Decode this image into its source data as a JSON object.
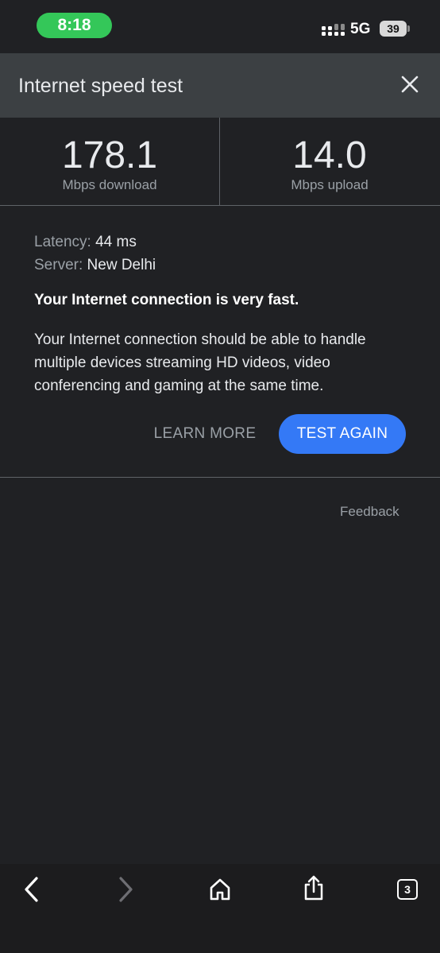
{
  "status_bar": {
    "time": "8:18",
    "network": "5G",
    "battery": "39"
  },
  "header": {
    "title": "Internet speed test"
  },
  "results": {
    "download": {
      "value": "178.1",
      "unit": "Mbps download"
    },
    "upload": {
      "value": "14.0",
      "unit": "Mbps upload"
    }
  },
  "details": {
    "latency_label": "Latency:",
    "latency_value": "44 ms",
    "server_label": "Server:",
    "server_value": "New Delhi"
  },
  "verdict": "Your Internet connection is very fast.",
  "description": "Your Internet connection should be able to handle multiple devices streaming HD videos, video conferencing and gaming at the same time.",
  "actions": {
    "learn_more": "LEARN MORE",
    "test_again": "TEST AGAIN"
  },
  "feedback": "Feedback",
  "toolbar": {
    "tab_count": "3"
  },
  "colors": {
    "accent": "#3479f6",
    "time_pill": "#34c759",
    "header_bg": "#3c4043",
    "page_bg": "#202124"
  }
}
